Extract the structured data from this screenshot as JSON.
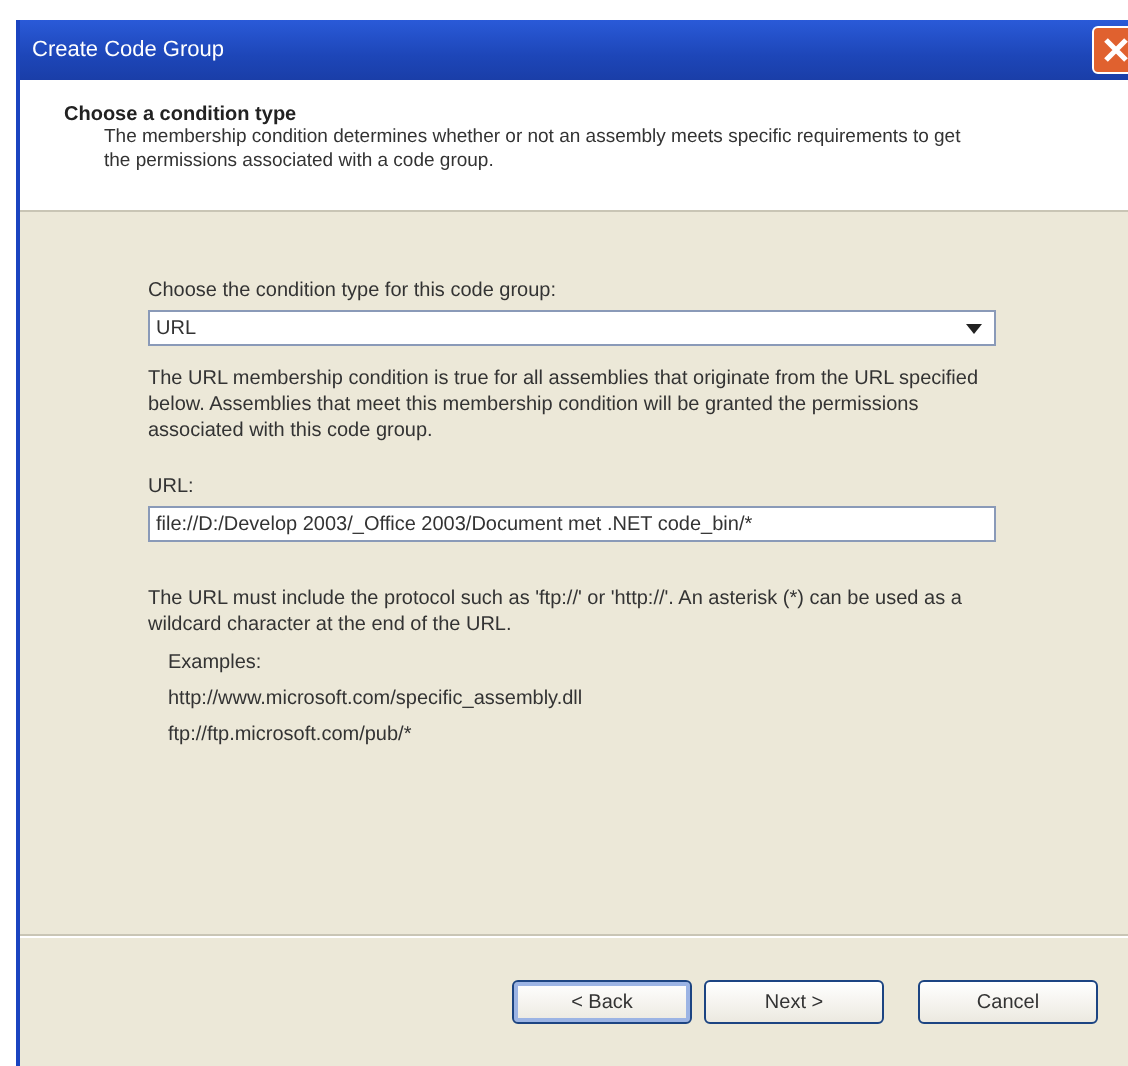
{
  "window": {
    "title": "Create Code Group"
  },
  "header": {
    "title": "Choose a condition type",
    "description": "The membership condition determines whether or not an assembly meets specific requirements to get the permissions associated with a code group."
  },
  "condition_type": {
    "label": "Choose the condition type for this code group:",
    "value": "URL"
  },
  "condition_description": "The URL membership condition is true for all assemblies that originate from the URL specified below.  Assemblies that meet this membership condition will be granted the permissions associated with this code group.",
  "url": {
    "label": "URL:",
    "value": "file://D:/Develop 2003/_Office 2003/Document met .NET code_bin/*"
  },
  "help": "The URL must include the protocol such as 'ftp://' or 'http://'.  An asterisk (*) can be used as a wildcard character at the end of the URL.",
  "examples": {
    "label": "Examples:",
    "items": [
      "http://www.microsoft.com/specific_assembly.dll",
      "ftp://ftp.microsoft.com/pub/*"
    ]
  },
  "buttons": [
    {
      "label": "< Back",
      "default": true
    },
    {
      "label": "Next >",
      "default": false
    },
    {
      "label": "Cancel",
      "default": false
    }
  ]
}
